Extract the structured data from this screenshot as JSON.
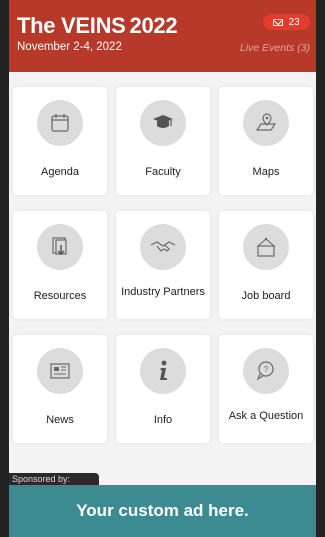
{
  "header": {
    "title": "The VEINS",
    "year": "2022",
    "date": "November 2-4, 2022",
    "notifications": "23",
    "live_events": "Live Events (3)"
  },
  "tiles": [
    {
      "label": "Agenda",
      "icon": "calendar-icon"
    },
    {
      "label": "Faculty",
      "icon": "graduation-cap-icon"
    },
    {
      "label": "Maps",
      "icon": "map-pin-icon"
    },
    {
      "label": "Resources",
      "icon": "document-download-icon"
    },
    {
      "label": "Industry Partners",
      "icon": "handshake-icon"
    },
    {
      "label": "Job board",
      "icon": "hanging-sign-icon"
    },
    {
      "label": "News",
      "icon": "newspaper-icon"
    },
    {
      "label": "Info",
      "icon": "info-icon"
    },
    {
      "label": "Ask a Question",
      "icon": "question-bubble-icon"
    }
  ],
  "sponsored_label": "Sponsored by:",
  "ad_text": "Your custom ad here.",
  "colors": {
    "header_bg": "#b7392a",
    "badge_bg": "#e43c2c",
    "ad_bg": "#3b8b91"
  }
}
